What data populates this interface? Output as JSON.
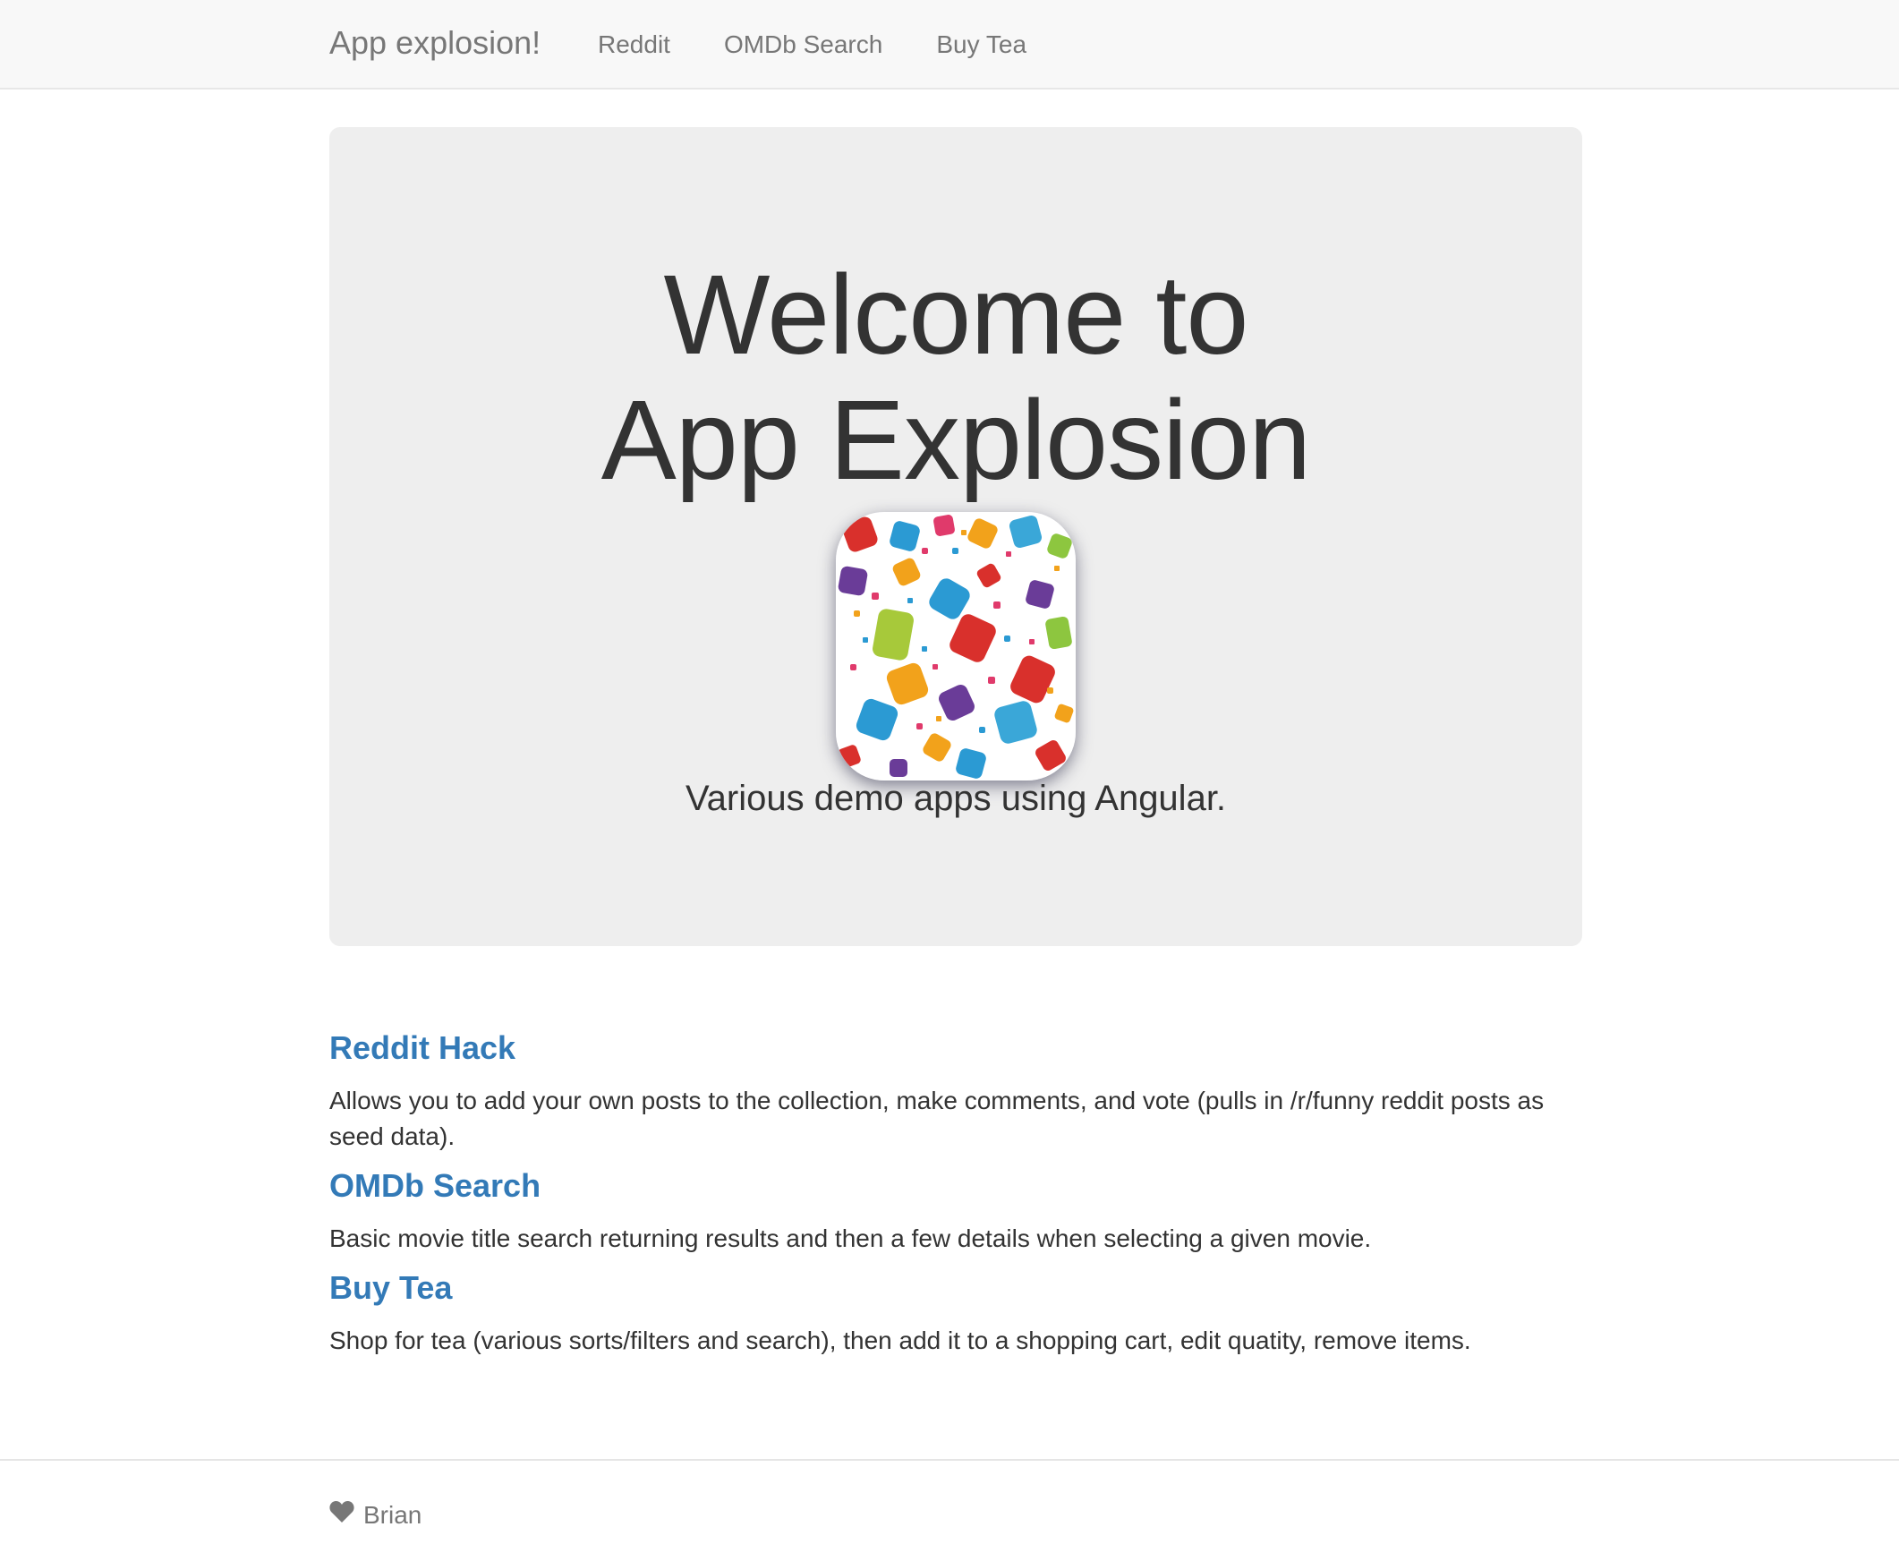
{
  "navbar": {
    "brand": "App explosion!",
    "links": [
      {
        "label": "Reddit"
      },
      {
        "label": "OMDb Search"
      },
      {
        "label": "Buy Tea"
      }
    ]
  },
  "hero": {
    "title_line1": "Welcome to",
    "title_line2": "App Explosion",
    "icon": "app-explosion-logo",
    "subtitle": "Various demo apps using Angular."
  },
  "apps": [
    {
      "title": "Reddit Hack",
      "description": "Allows you to add your own posts to the collection, make comments, and vote (pulls in /r/funny reddit posts as seed data)."
    },
    {
      "title": "OMDb Search",
      "description": "Basic movie title search returning results and then a few details when selecting a given movie."
    },
    {
      "title": "Buy Tea",
      "description": "Shop for tea (various sorts/filters and search), then add it to a shopping cart, edit quatity, remove items."
    }
  ],
  "footer": {
    "icon": "heart-icon",
    "author": "Brian"
  },
  "colors": {
    "link": "#337ab7",
    "navbar_bg": "#f8f8f8",
    "jumbotron_bg": "#eeeeee",
    "text": "#333333",
    "muted": "#777777"
  }
}
